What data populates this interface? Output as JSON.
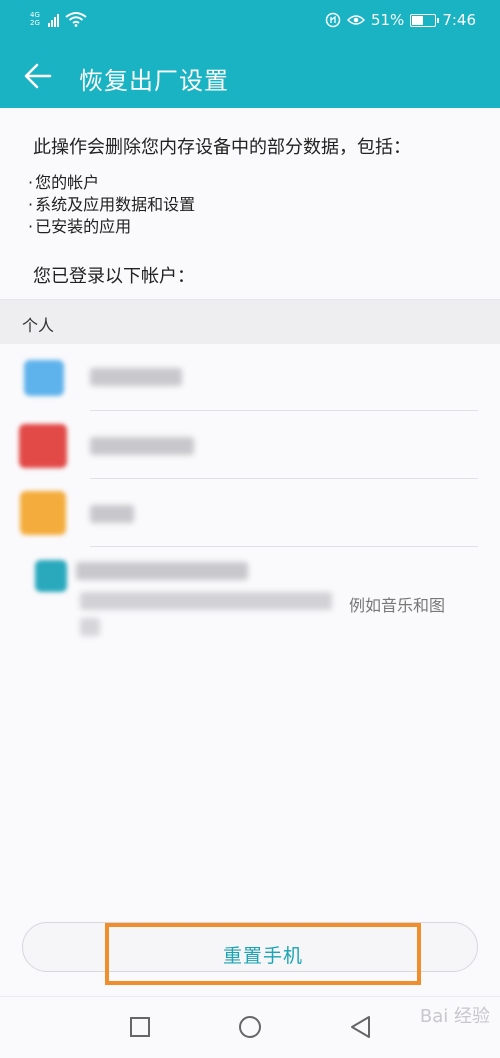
{
  "status_bar": {
    "network_top": "4G",
    "network_bottom": "2G",
    "battery_text": "51%",
    "battery_level": 0.51,
    "time": "7:46"
  },
  "app_bar": {
    "title": "恢复出厂设置",
    "back_icon": "arrow-left-icon"
  },
  "content": {
    "intro": "此操作会删除您内存设备中的部分数据，包括：",
    "bullets": [
      "您的帐户",
      "系统及应用数据和设置",
      "已安装的应用"
    ],
    "logged_in_heading": "您已登录以下帐户：",
    "section_label": "个人",
    "partial_visible_text": "例如音乐和图"
  },
  "actions": {
    "reset_label": "重置手机"
  },
  "nav_bar": {
    "icons": [
      "square-icon",
      "circle-icon",
      "triangle-back-icon"
    ]
  },
  "watermark": "Bai 经验",
  "colors": {
    "accent": "#19b3c4",
    "highlight": "#f08d2c",
    "button_text": "#1aa4b4"
  }
}
